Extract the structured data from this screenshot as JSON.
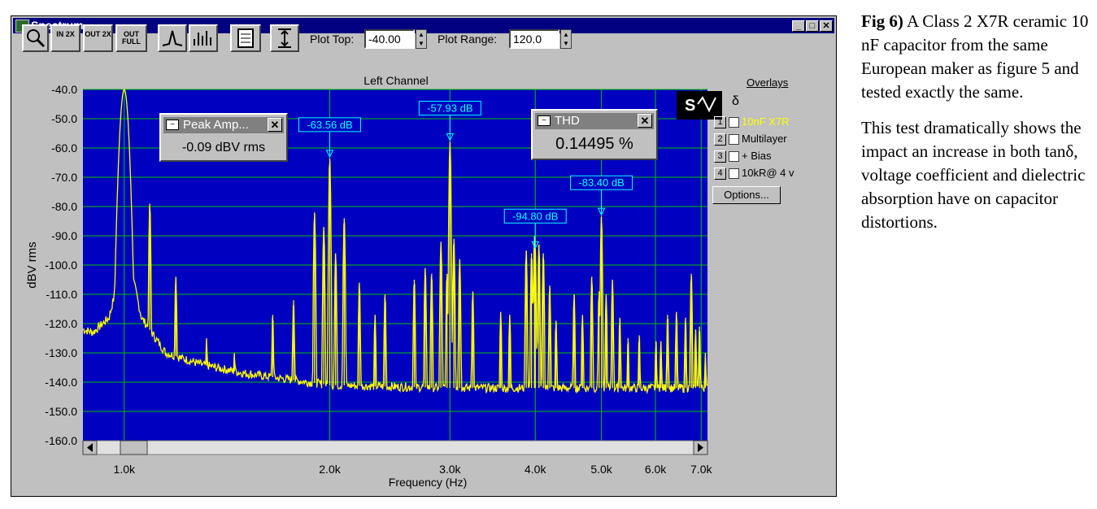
{
  "window": {
    "title": "Spectrum",
    "controls": {
      "minimize": "_",
      "maximize": "□",
      "close": "✕"
    }
  },
  "toolbar": {
    "zoom_icon": "magnifier-icon",
    "zoom_in_2x": "IN 2X",
    "zoom_out_2x": "OUT 2X",
    "zoom_out_full": "OUT FULL",
    "plot_top_label": "Plot Top:",
    "plot_top_value": "-40.00",
    "plot_range_label": "Plot Range:",
    "plot_range_value": "120.0"
  },
  "overlays": {
    "header": "Overlays",
    "items": [
      {
        "num": "1",
        "label": "10nF X7R",
        "color": "#ffff00"
      },
      {
        "num": "2",
        "label": "Multilayer",
        "color": "#000000"
      },
      {
        "num": "3",
        "label": "+ Bias",
        "color": "#000000"
      },
      {
        "num": "4",
        "label": "10kR@ 4 v",
        "color": "#000000"
      }
    ],
    "options_label": "Options..."
  },
  "peak_panel": {
    "title": "Peak Amp...",
    "value": "-0.09 dBV rms"
  },
  "thd_panel": {
    "title": "THD",
    "value": "0.14495 %"
  },
  "caption": {
    "fig_label": "Fig 6)",
    "p1": " A Class 2 X7R ceramic 10 nF capacitor from the same European maker as figure 5 and tested exactly the same.",
    "p2": "This test dramatically shows the impact an increase in both tanδ, voltage coefficient and dielectric absorption have on capacitor distortions."
  },
  "chart_data": {
    "type": "line",
    "title": "Left Channel",
    "xlabel": "Frequency (Hz)",
    "ylabel": "dBV rms",
    "x_scale": "log",
    "xlim": [
      870,
      7150
    ],
    "ylim": [
      -160,
      -40
    ],
    "x_ticks": [
      {
        "value": 1000,
        "label": "1.0k"
      },
      {
        "value": 2000,
        "label": "2.0k"
      },
      {
        "value": 3000,
        "label": "3.0k"
      },
      {
        "value": 4000,
        "label": "4.0k"
      },
      {
        "value": 5000,
        "label": "5.0k"
      },
      {
        "value": 6000,
        "label": "6.0k"
      },
      {
        "value": 7000,
        "label": "7.0k"
      }
    ],
    "y_ticks": [
      -40,
      -50,
      -60,
      -70,
      -80,
      -90,
      -100,
      -110,
      -120,
      -130,
      -140,
      -150,
      -160
    ],
    "y_tick_labels": [
      "-40.0",
      "-50.0",
      "-60.0",
      "-70.0",
      "-80.0",
      "-90.0",
      "-100.0",
      "-110.0",
      "-120.0",
      "-130.0",
      "-140.0",
      "-150.0",
      "-160.0"
    ],
    "grid": true,
    "background": "#0000c0",
    "grid_color": "#00c000",
    "line_color": "#ffff00",
    "series": [
      {
        "name": "10nF X7R",
        "noise_floor": [
          [
            870,
            -122
          ],
          [
            900,
            -123
          ],
          [
            950,
            -118
          ],
          [
            980,
            -105
          ],
          [
            1000,
            -40
          ],
          [
            1020,
            -100
          ],
          [
            1060,
            -118
          ],
          [
            1150,
            -130
          ],
          [
            1300,
            -134
          ],
          [
            1500,
            -137
          ],
          [
            2000,
            -141
          ],
          [
            3000,
            -142
          ],
          [
            4000,
            -142
          ],
          [
            5000,
            -142
          ],
          [
            7150,
            -142
          ]
        ],
        "peaks": [
          [
            1000,
            -40
          ],
          [
            1090,
            -79
          ],
          [
            1190,
            -104
          ],
          [
            1320,
            -125
          ],
          [
            1450,
            -130
          ],
          [
            1650,
            -117
          ],
          [
            1770,
            -112
          ],
          [
            1900,
            -82
          ],
          [
            1960,
            -87
          ],
          [
            2000,
            -63.56
          ],
          [
            2040,
            -96
          ],
          [
            2100,
            -84
          ],
          [
            2210,
            -106
          ],
          [
            2330,
            -117
          ],
          [
            2410,
            -110
          ],
          [
            2660,
            -105
          ],
          [
            2760,
            -101
          ],
          [
            2820,
            -103
          ],
          [
            2910,
            -92
          ],
          [
            2970,
            -103
          ],
          [
            3000,
            -57.93
          ],
          [
            3040,
            -91
          ],
          [
            3100,
            -98
          ],
          [
            3240,
            -109
          ],
          [
            3560,
            -116
          ],
          [
            3670,
            -117
          ],
          [
            3880,
            -95
          ],
          [
            3950,
            -96
          ],
          [
            3990,
            -90
          ],
          [
            4000,
            -94.8
          ],
          [
            4050,
            -93
          ],
          [
            4110,
            -96
          ],
          [
            4200,
            -107
          ],
          [
            4290,
            -119
          ],
          [
            4560,
            -110
          ],
          [
            4690,
            -117
          ],
          [
            4840,
            -104
          ],
          [
            4960,
            -109
          ],
          [
            5000,
            -83.4
          ],
          [
            5080,
            -110
          ],
          [
            5190,
            -105
          ],
          [
            5320,
            -118
          ],
          [
            5470,
            -125
          ],
          [
            5680,
            -124
          ],
          [
            6010,
            -126
          ],
          [
            6110,
            -126
          ],
          [
            6250,
            -117
          ],
          [
            6440,
            -116
          ],
          [
            6640,
            -118
          ],
          [
            6770,
            -103
          ],
          [
            6870,
            -122
          ],
          [
            6960,
            -121
          ],
          [
            7100,
            -130
          ]
        ]
      }
    ],
    "markers": [
      {
        "x": 2000,
        "y": -63.56,
        "label": "-63.56 dB"
      },
      {
        "x": 3000,
        "y": -57.93,
        "label": "-57.93 dB"
      },
      {
        "x": 4000,
        "y": -94.8,
        "label": "-94.80 dB"
      },
      {
        "x": 5000,
        "y": -83.4,
        "label": "-83.40 dB"
      }
    ]
  }
}
